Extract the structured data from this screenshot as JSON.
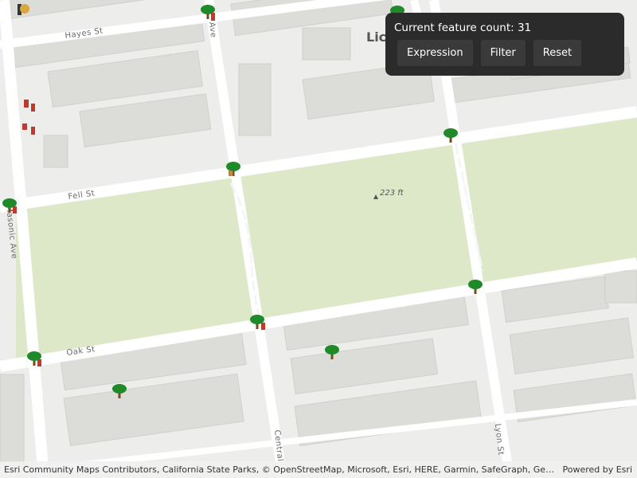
{
  "panel": {
    "count_label": "Current feature count:",
    "count_value": "31",
    "buttons": {
      "expression": "Expression",
      "filter": "Filter",
      "reset": "Reset"
    }
  },
  "map": {
    "streets": {
      "hayes": "Hayes St",
      "fell": "Fell St",
      "oak": "Oak St",
      "masonic": "Masonic Ave",
      "central": "Central",
      "lyon": "Lyon St",
      "ave_fragment": "Ave"
    },
    "place_label": "Lic",
    "elevation_label": "223 ft",
    "colors": {
      "park": "#dde8c8",
      "road": "#ffffff",
      "building": "#dcdcd8",
      "background": "#ededec",
      "tree": "#1e8a2a",
      "trunk": "#7a4a1c"
    }
  },
  "attribution": {
    "text": "Esri Community Maps Contributors, California State Parks, © OpenStreetMap, Microsoft, Esri, HERE, Garmin, SafeGraph, GeoTechnologies",
    "powered_by": "Powered by Esri"
  }
}
